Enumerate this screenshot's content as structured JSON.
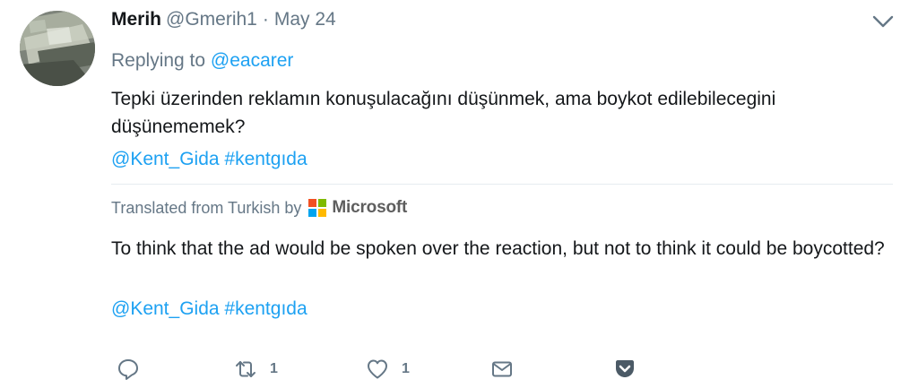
{
  "tweet": {
    "author_name": "Merih",
    "author_handle": "@Gmerih1",
    "separator": "·",
    "date": "May 24",
    "replying_prefix": "Replying to",
    "replying_to": "@eacarer",
    "text_original": "Tepki üzerinden reklamın konuşulacağını düşünmek, ama boykot edilebilecegini düşünememek?",
    "tags_original": "@Kent_Gida #kentgıda",
    "translated_label": "Translated from Turkish by",
    "translator_name": "Microsoft",
    "text_translated": "To think that the ad would be spoken over the reaction, but not to think it could be boycotted?",
    "tags_translated": "@Kent_Gida #kentgıda"
  },
  "actions": {
    "reply_icon": "reply-icon",
    "retweet_icon": "retweet-icon",
    "retweet_count": "1",
    "like_icon": "heart-icon",
    "like_count": "1",
    "dm_icon": "envelope-icon",
    "save_icon": "pocket-icon"
  },
  "colors": {
    "link": "#1da1f2",
    "secondary_text": "#657786",
    "primary_text": "#14171a",
    "icon": "#657786",
    "pocket": "#4b5a66",
    "ms_red": "#f25022",
    "ms_green": "#7fba00",
    "ms_blue": "#00a4ef",
    "ms_yellow": "#ffb900"
  }
}
